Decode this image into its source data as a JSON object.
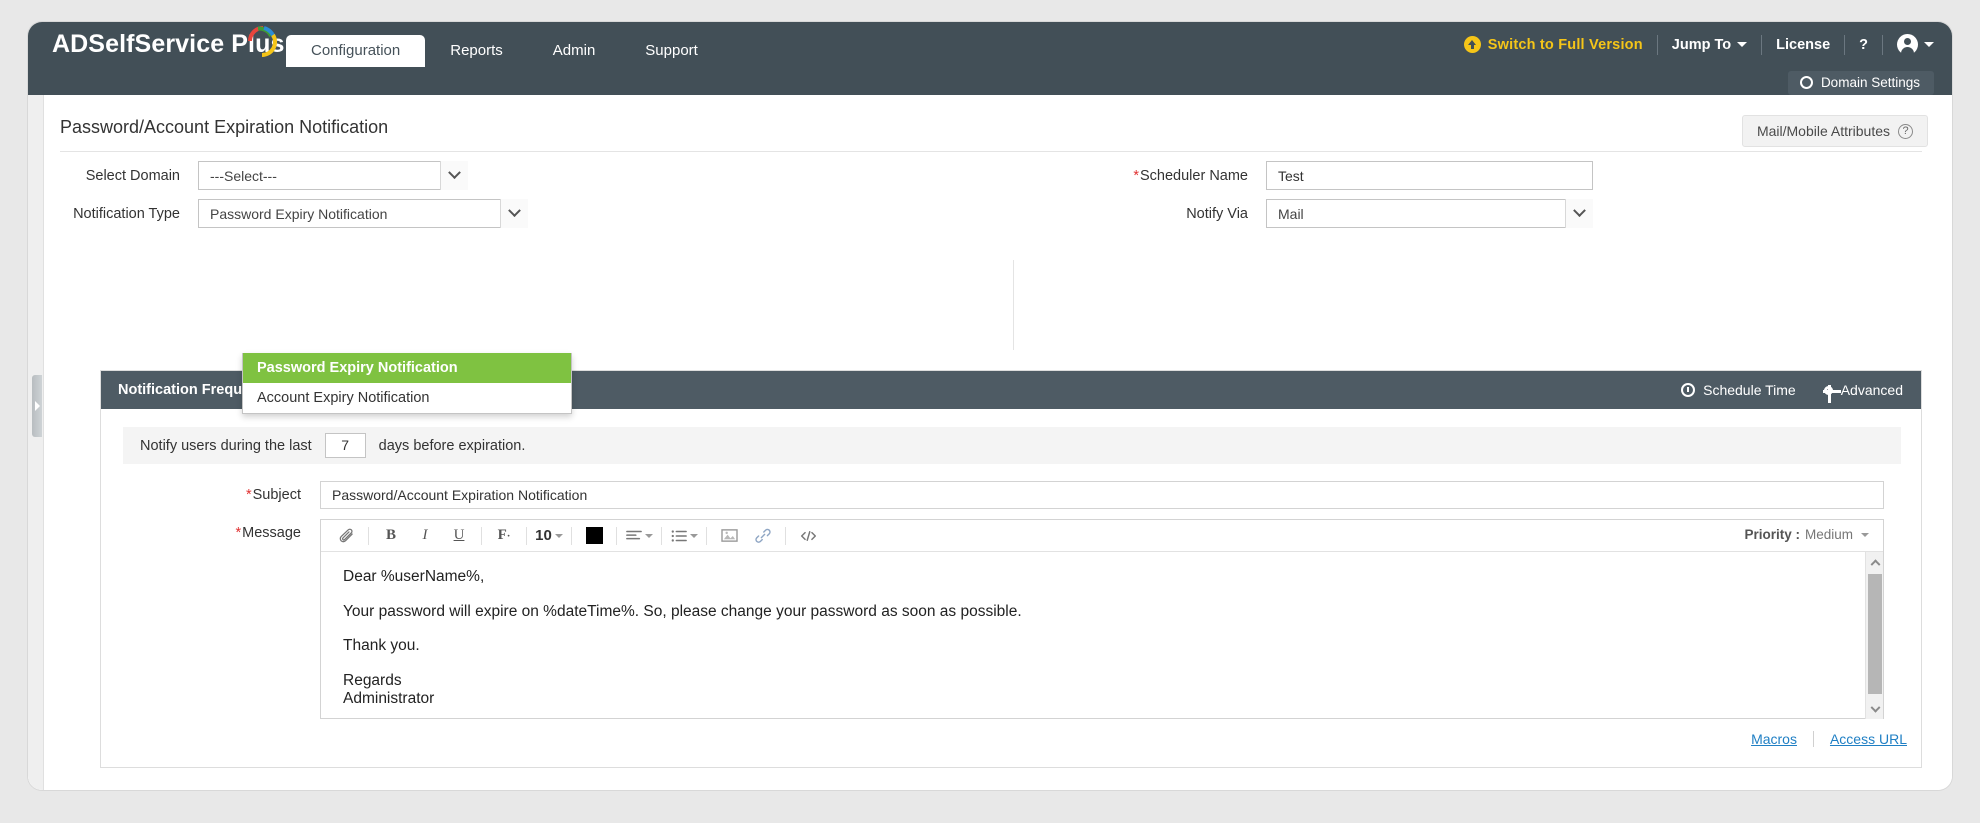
{
  "product": {
    "name": "ADSelfService Plus"
  },
  "topbar": {
    "switch_full_version": "Switch to Full Version",
    "jump_to": "Jump To",
    "license": "License",
    "help": "?",
    "domain_settings": "Domain Settings"
  },
  "nav": {
    "tabs": [
      {
        "label": "Configuration",
        "active": true
      },
      {
        "label": "Reports",
        "active": false
      },
      {
        "label": "Admin",
        "active": false
      },
      {
        "label": "Support",
        "active": false
      }
    ]
  },
  "page": {
    "title": "Password/Account Expiration Notification",
    "mail_mobile_attributes": "Mail/Mobile Attributes"
  },
  "form": {
    "select_domain_label": "Select Domain",
    "select_domain_value": "---Select---",
    "notification_type_label": "Notification Type",
    "notification_type_value": "Password Expiry Notification",
    "notification_type_options": [
      {
        "label": "Password Expiry Notification",
        "selected": true
      },
      {
        "label": "Account Expiry Notification",
        "selected": false
      }
    ],
    "scheduler_name_label": "Scheduler Name",
    "scheduler_name_value": "Test",
    "notify_via_label": "Notify Via",
    "notify_via_value": "Mail"
  },
  "panel": {
    "title": "Notification Frequency",
    "schedule_time": "Schedule Time",
    "advanced": "Advanced",
    "notify_prefix": "Notify users during the last",
    "notify_days": "7",
    "notify_suffix": "days before expiration.",
    "subject_label": "Subject",
    "subject_value": "Password/Account Expiration Notification",
    "message_label": "Message"
  },
  "editor": {
    "font_size": "10",
    "font_button": "F",
    "bold": "B",
    "italic": "I",
    "underline": "U",
    "color_hex": "#000000",
    "priority_label": "Priority :",
    "priority_value": "Medium",
    "message_lines": [
      "Dear %userName%,",
      "Your password will expire on %dateTime%. So, please change your password as soon as possible.",
      "Thank you.",
      "Regards",
      "Administrator"
    ],
    "macros_link": "Macros",
    "access_url_link": "Access URL"
  },
  "colors": {
    "header_dark": "#424f57",
    "panel_dark": "#4e5b64",
    "accent_green": "#7fc241",
    "accent_yellow": "#f5c518",
    "link_blue": "#1f7fc4"
  }
}
